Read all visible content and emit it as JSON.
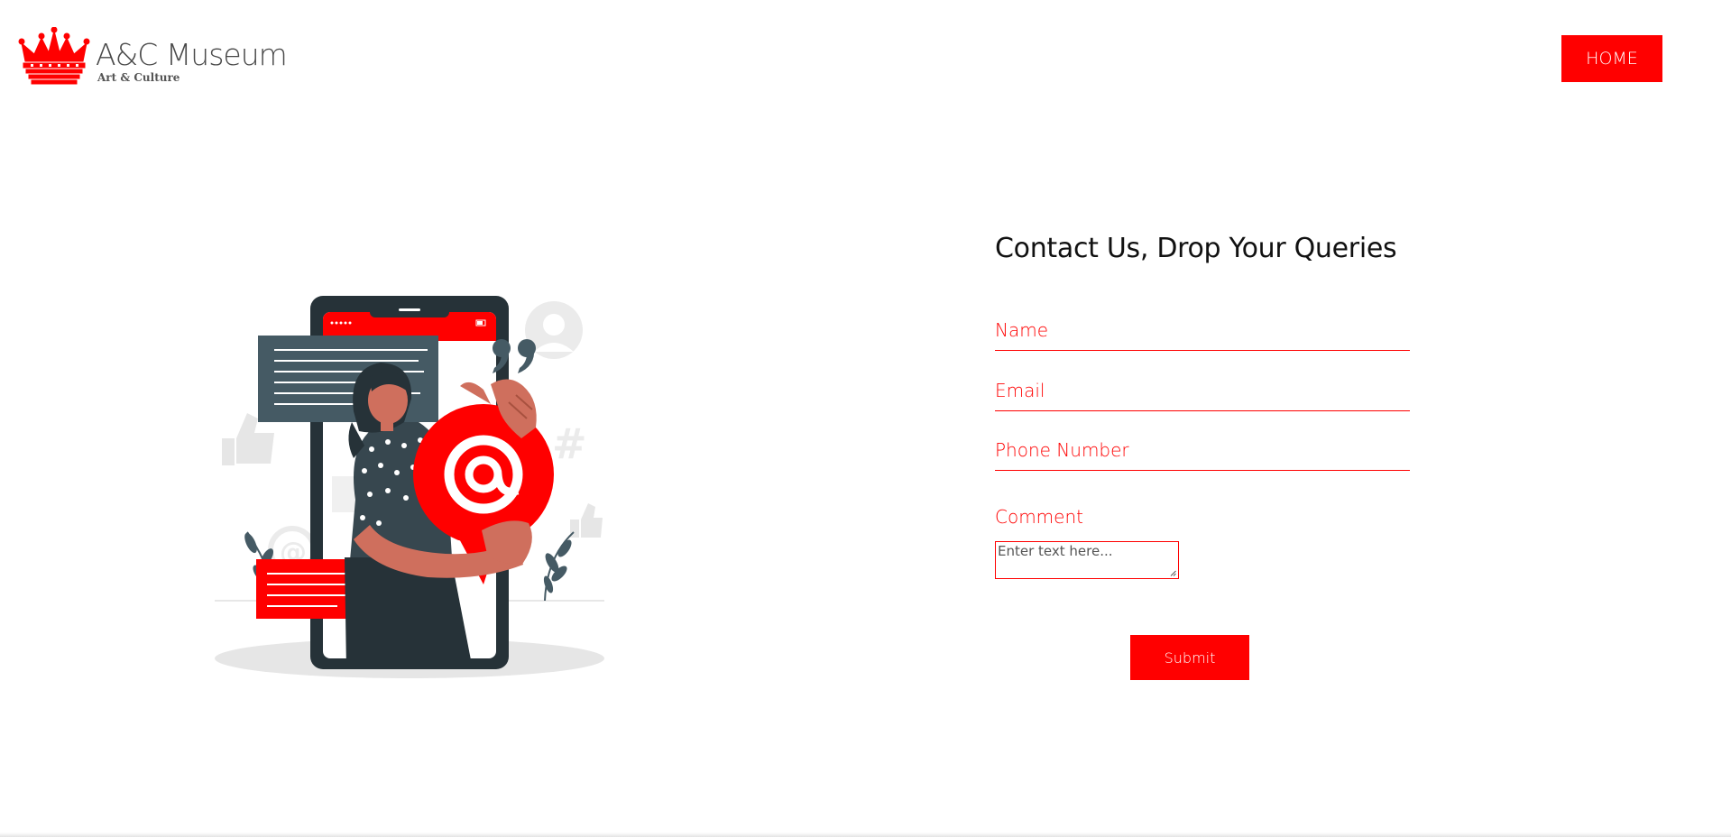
{
  "header": {
    "logo_title": "A&C Museum",
    "logo_subtitle": "Art & Culture",
    "home_label": "HOME"
  },
  "form": {
    "title": "Contact Us, Drop Your Queries",
    "name_label": "Name",
    "email_label": "Email",
    "phone_label": "Phone Number",
    "comment_label": "Comment",
    "comment_placeholder": "Enter text here...",
    "submit_label": "Submit"
  },
  "colors": {
    "accent": "#ff0000",
    "text_dark": "#111111",
    "illustration_dark": "#263238",
    "illustration_slate": "#455a64",
    "skin": "#cf6f5d"
  },
  "icons": {
    "logo": "crown-icon",
    "illustration": "contact-us-email-illustration"
  }
}
